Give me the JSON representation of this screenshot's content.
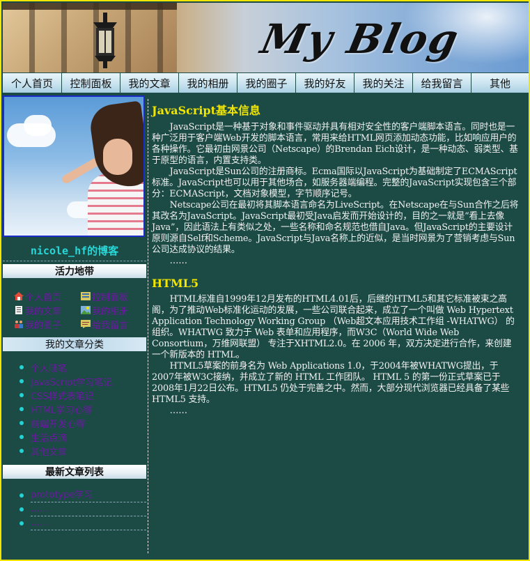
{
  "banner": {
    "title": "My Blog"
  },
  "nav": [
    "个人首页",
    "控制面板",
    "我的文章",
    "我的相册",
    "我的圈子",
    "我的好友",
    "我的关注",
    "给我留言",
    "其他"
  ],
  "sidebar": {
    "blog_name": "nicole_hf的博客",
    "vitality_title": "活力地带",
    "quick_links": [
      "个人首页",
      "控制面板",
      "我的文章",
      "我的相册",
      "我的圈子",
      "给我留言"
    ],
    "categories_title": "我的文章分类",
    "categories": [
      "个人随笔",
      "JavaScript学习笔记",
      "CSS样式表笔记",
      "HTML学习心得",
      "前端开发心得",
      "生活点滴",
      "其他文章"
    ],
    "recent_title": "最新文章列表",
    "recent": [
      "prototype学习",
      "……",
      "……"
    ]
  },
  "posts": [
    {
      "title": "JavaScript基本信息",
      "paragraphs": [
        "JavaScript是一种基于对象和事件驱动并具有相对安全性的客户端脚本语言。同时也是一种广泛用于客户端Web开发的脚本语言，常用来给HTML网页添加动态功能，比如响应用户的各种操作。它最初由网景公司（Netscape）的Brendan Eich设计，是一种动态、弱类型、基于原型的语言，内置支持类。",
        "JavaScript是Sun公司的注册商标。Ecma国际以JavaScript为基础制定了ECMAScript标准。JavaScript也可以用于其他场合，如服务器端编程。完整的JavaScript实现包含三个部分：ECMAScript，文档对象模型，字节顺序记号。",
        "Netscape公司在最初将其脚本语言命名为LiveScript。在Netscape在与Sun合作之后将其改名为JavaScript。JavaScript最初受Java启发而开始设计的，目的之一就是“看上去像Java”，因此语法上有类似之处，一些名称和命名规范也借自Java。但JavaScript的主要设计原则源自Self和Scheme。JavaScript与Java名称上的近似，是当时网景为了营销考虑与Sun公司达成协议的结果。",
        "……"
      ]
    },
    {
      "title": "HTML5",
      "paragraphs": [
        "HTML标准自1999年12月发布的HTML4.01后，后继的HTML5和其它标准被束之高阁，为了推动Web标准化运动的发展，一些公司联合起来，成立了一个叫做 Web Hypertext Application Technology Working Group （Web超文本应用技术工作组 -WHATWG） 的组织。WHATWG 致力于 Web 表单和应用程序，而W3C（World Wide Web Consortium，万维网联盟） 专注于XHTML2.0。在 2006 年，双方决定进行合作，来创建一个新版本的 HTML。",
        "HTML5草案的前身名为 Web Applications 1.0，于2004年被WHATWG提出，于2007年被W3C接纳，并成立了新的 HTML 工作团队。 HTML 5 的第一份正式草案已于2008年1月22日公布。HTML5 仍处于完善之中。然而，大部分现代浏览器已经具备了某些 HTML5 支持。",
        "……"
      ]
    }
  ],
  "colors": {
    "background": "#1c4a45",
    "frame": "#f2e600",
    "title": "#f2e600",
    "link": "#6a1aa0",
    "accent": "#27d7d7"
  }
}
